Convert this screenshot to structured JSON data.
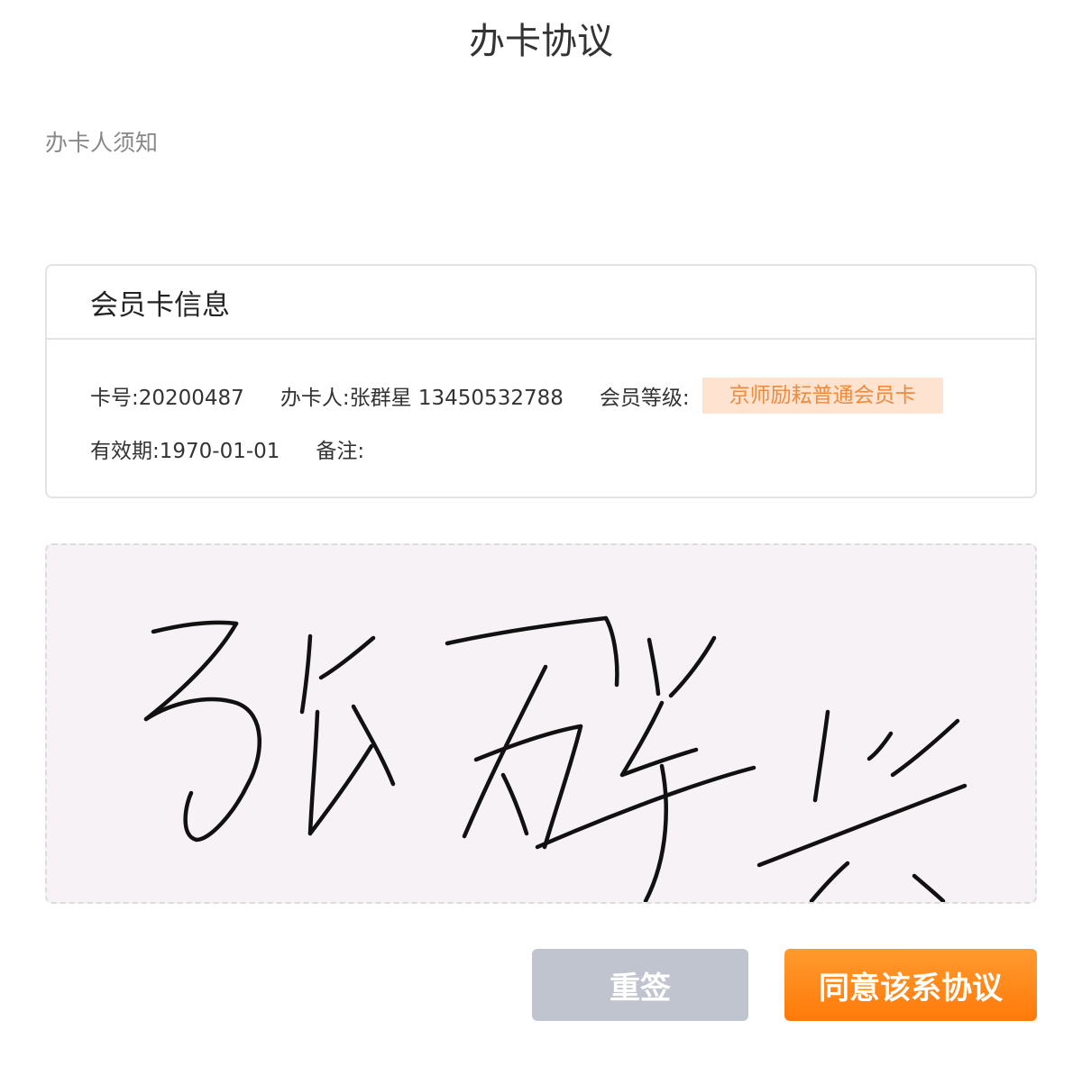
{
  "page": {
    "title": "办卡协议"
  },
  "notice": {
    "label": "办卡人须知"
  },
  "card_info": {
    "title": "会员卡信息",
    "card_number": "卡号:20200487",
    "holder": "办卡人:张群星 13450532788",
    "level_label": "会员等级:",
    "level_value": "京师励耘普通会员卡",
    "valid_until": "有效期:1970-01-01",
    "remark": "备注:"
  },
  "signature": {
    "handwritten_text": "张群兴",
    "ink_color": "#111111",
    "pad_color": "#f7f2f5"
  },
  "actions": {
    "resign_label": "重签",
    "agree_label": "同意该系协议"
  },
  "colors": {
    "accent": "#ff8a1a",
    "badge_bg": "#fde3d0",
    "badge_text": "#f08a3c",
    "disabled_button": "#c0c4cf"
  }
}
